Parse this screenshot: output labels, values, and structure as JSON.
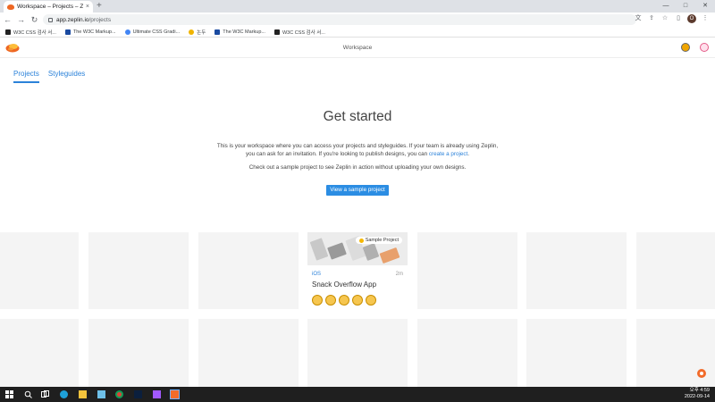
{
  "browser": {
    "tab_title": "Workspace – Projects – Zeplin",
    "tab_close": "×",
    "new_tab": "+",
    "url_host": "app.zeplin.io",
    "url_path": "/projects",
    "window_controls": [
      "—",
      "□",
      "✕"
    ],
    "profile_initial": "O",
    "bookmarks": [
      {
        "label": "W3C CSS 검사 서...",
        "color": "#222222"
      },
      {
        "label": "The W3C Markup...",
        "color": "#1a4aa0"
      },
      {
        "label": "Ultimate CSS Gradi...",
        "color": "#4285f4"
      },
      {
        "label": "논두",
        "color": "#f0b400"
      },
      {
        "label": "The W3C Markup...",
        "color": "#1a4aa0"
      },
      {
        "label": "W3C CSS 검사 서...",
        "color": "#222222"
      }
    ]
  },
  "app": {
    "workspace_title": "Workspace",
    "tabs": [
      {
        "label": "Projects",
        "active": true
      },
      {
        "label": "Styleguides",
        "active": false
      }
    ],
    "hero": {
      "title": "Get started",
      "text_before_link": "This is your workspace where you can access your projects and styleguides. If your team is already using Zeplin, you can ask for an invitation. If you're looking to publish designs, you can ",
      "link_text": "create a project",
      "text_after_link": ".",
      "text2": "Check out a sample project to see Zeplin in action without uploading your own designs.",
      "cta_label": "View a sample project"
    },
    "project": {
      "badge": "Sample Project",
      "platform": "iOS",
      "age": "2m",
      "name": "Snack Overflow App"
    },
    "colors": {
      "accent": "#2b82d9",
      "button": "#2b8de3",
      "placeholder": "#f4f4f4"
    }
  },
  "taskbar": {
    "time": "오후 4:59",
    "date": "2022-09-14"
  }
}
